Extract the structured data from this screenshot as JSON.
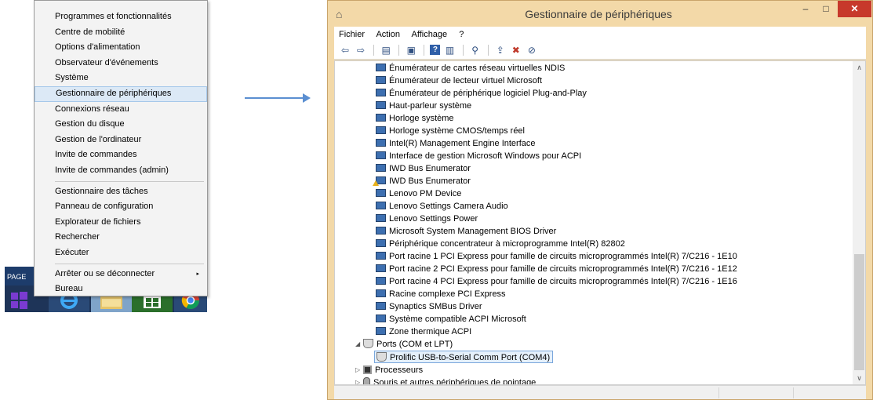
{
  "context_menu": {
    "items": [
      "Programmes et fonctionnalités",
      "Centre de mobilité",
      "Options d'alimentation",
      "Observateur d'événements",
      "Système",
      "Gestionnaire de périphériques",
      "Connexions réseau",
      "Gestion du disque",
      "Gestion de l'ordinateur",
      "Invite de commandes",
      "Invite de commandes (admin)",
      "Gestionnaire des tâches",
      "Panneau de configuration",
      "Explorateur de fichiers",
      "Rechercher",
      "Exécuter",
      "Arrêter ou se déconnecter",
      "Bureau"
    ],
    "highlighted": "Gestionnaire de périphériques",
    "submenu_arrow": "▸"
  },
  "background_label": "PAGE",
  "window": {
    "title": "Gestionnaire de périphériques",
    "app_icon": "⌂",
    "controls": {
      "minimize": "–",
      "maximize": "□",
      "close": "✕"
    }
  },
  "menubar": [
    "Fichier",
    "Action",
    "Affichage",
    "?"
  ],
  "toolbar_icons": [
    "back-icon",
    "forward-icon",
    "show-hide-icon",
    "properties-icon",
    "help-icon",
    "view-icon",
    "scan-icon",
    "update-driver-icon",
    "uninstall-icon",
    "disable-icon"
  ],
  "tree": {
    "system_devices": [
      {
        "label": "Énumérateur de cartes réseau virtuelles NDIS",
        "warn": false
      },
      {
        "label": "Énumérateur de lecteur virtuel Microsoft",
        "warn": false
      },
      {
        "label": "Énumérateur de périphérique logiciel Plug-and-Play",
        "warn": false
      },
      {
        "label": "Haut-parleur système",
        "warn": false
      },
      {
        "label": "Horloge système",
        "warn": false
      },
      {
        "label": "Horloge système CMOS/temps réel",
        "warn": false
      },
      {
        "label": "Intel(R) Management Engine Interface",
        "warn": false
      },
      {
        "label": "Interface de gestion Microsoft Windows pour ACPI",
        "warn": false
      },
      {
        "label": "IWD Bus Enumerator",
        "warn": false
      },
      {
        "label": "IWD Bus Enumerator",
        "warn": true
      },
      {
        "label": "Lenovo PM Device",
        "warn": false
      },
      {
        "label": "Lenovo Settings Camera Audio",
        "warn": false
      },
      {
        "label": "Lenovo Settings Power",
        "warn": false
      },
      {
        "label": "Microsoft System Management BIOS Driver",
        "warn": false
      },
      {
        "label": "Périphérique concentrateur à microprogramme Intel(R) 82802",
        "warn": false
      },
      {
        "label": "Port racine 1 PCI Express pour famille de circuits microprogrammés Intel(R) 7/C216 - 1E10",
        "warn": false
      },
      {
        "label": "Port racine 2 PCI Express pour famille de circuits microprogrammés Intel(R) 7/C216 - 1E12",
        "warn": false
      },
      {
        "label": "Port racine 4 PCI Express pour famille de circuits microprogrammés Intel(R) 7/C216 - 1E16",
        "warn": false
      },
      {
        "label": "Racine complexe PCI Express",
        "warn": false
      },
      {
        "label": "Synaptics SMBus Driver",
        "warn": false
      },
      {
        "label": "Système compatible ACPI Microsoft",
        "warn": false
      },
      {
        "label": "Zone thermique ACPI",
        "warn": false
      }
    ],
    "ports_category": "Ports (COM et LPT)",
    "ports_child": "Prolific USB-to-Serial Comm Port (COM4)",
    "processors": "Processeurs",
    "mice": "Souris et autres périphériques de pointage"
  },
  "scrollbar": {
    "up": "∧",
    "down": "∨"
  }
}
